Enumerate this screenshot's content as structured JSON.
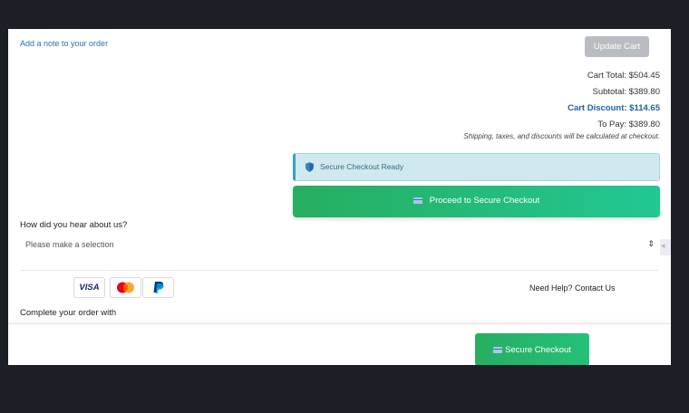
{
  "cart": {
    "note_link": "Add a note to your order",
    "update_label": "Update Cart",
    "totals": {
      "cart_total": "Cart Total: $504.45",
      "subtotal": "Subtotal: $389.80",
      "discount": "Cart Discount: $114.65",
      "to_pay": "To Pay: $389.80"
    },
    "shipping_note": "Shipping, taxes, and discounts will be calculated at checkout."
  },
  "checkout": {
    "ready_text": "Secure Checkout Ready",
    "proceed_label": "Proceed to Secure Checkout",
    "secure_label": "Secure Checkout"
  },
  "survey": {
    "question": "How did you hear about us?",
    "selected": "Please make a selection",
    "arrow": "⇕",
    "edge": "<"
  },
  "payment": {
    "visa": "VISA",
    "need_help": "Need Help? Contact Us",
    "complete": "Complete your order with"
  },
  "colors": {
    "accent_green": "#27ae60",
    "discount_blue": "#1f5fa3",
    "info_bg": "#cfe9ef",
    "link": "#2a6fb0"
  },
  "icons": [
    "shield-icon",
    "credit-card-icon",
    "visa-logo",
    "mastercard-logo",
    "paypal-logo",
    "select-arrow-icon"
  ]
}
